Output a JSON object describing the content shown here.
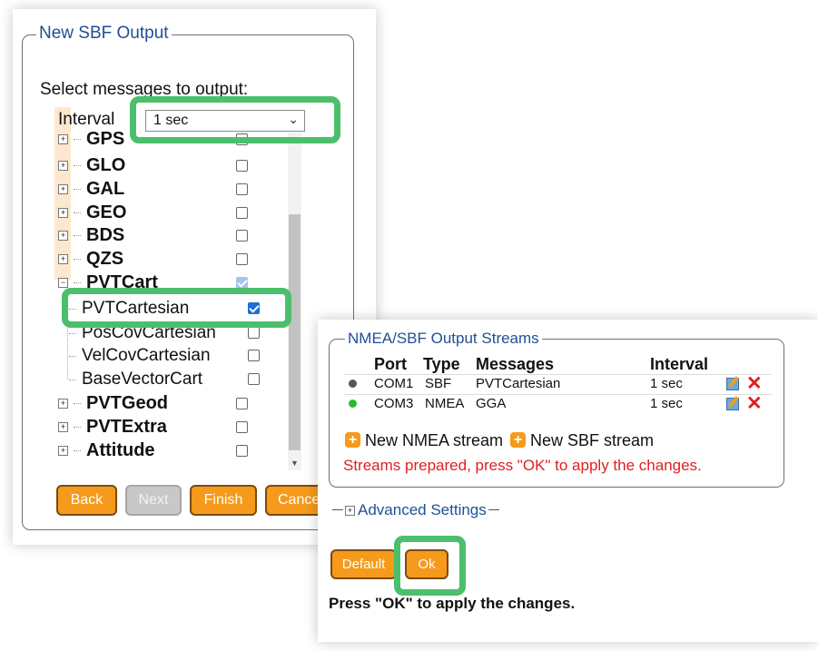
{
  "wizard": {
    "legend": "New SBF Output",
    "select_label": "Select messages to output:",
    "interval_label": "Interval",
    "interval_value": "1 sec",
    "tree": [
      {
        "label": "GPS",
        "group": true,
        "expanded": false,
        "checked": false
      },
      {
        "label": "GLO",
        "group": true,
        "expanded": false,
        "checked": false
      },
      {
        "label": "GAL",
        "group": true,
        "expanded": false,
        "checked": false
      },
      {
        "label": "GEO",
        "group": true,
        "expanded": false,
        "checked": false
      },
      {
        "label": "BDS",
        "group": true,
        "expanded": false,
        "checked": false
      },
      {
        "label": "QZS",
        "group": true,
        "expanded": false,
        "checked": false
      },
      {
        "label": "PVTCart",
        "group": true,
        "expanded": true,
        "checked": true
      },
      {
        "label": "PVTCartesian",
        "group": false,
        "checked": true
      },
      {
        "label": "PosCovCartesian",
        "group": false,
        "checked": false
      },
      {
        "label": "VelCovCartesian",
        "group": false,
        "checked": false
      },
      {
        "label": "BaseVectorCart",
        "group": false,
        "checked": false
      },
      {
        "label": "PVTGeod",
        "group": true,
        "expanded": false,
        "checked": false
      },
      {
        "label": "PVTExtra",
        "group": true,
        "expanded": false,
        "checked": false
      },
      {
        "label": "Attitude",
        "group": true,
        "expanded": false,
        "checked": false
      }
    ],
    "buttons": {
      "back": "Back",
      "next": "Next",
      "finish": "Finish",
      "cancel": "Cance"
    }
  },
  "streams": {
    "legend": "NMEA/SBF Output Streams",
    "headers": {
      "port": "Port",
      "type": "Type",
      "messages": "Messages",
      "interval": "Interval"
    },
    "rows": [
      {
        "status_color": "#555555",
        "port": "COM1",
        "type": "SBF",
        "messages": "PVTCartesian",
        "interval": "1 sec"
      },
      {
        "status_color": "#2eb82e",
        "port": "COM3",
        "type": "NMEA",
        "messages": "GGA",
        "interval": "1 sec"
      }
    ],
    "new_nmea": "New NMEA stream",
    "new_sbf": "New SBF stream",
    "status_message": "Streams prepared, press \"OK\" to apply the changes.",
    "advanced": "Advanced Settings",
    "buttons": {
      "default": "Default",
      "ok": "Ok"
    },
    "footer": "Press \"OK\" to apply the changes."
  },
  "colors": {
    "highlight": "#4cbf6c",
    "button": "#f59a1b",
    "legend": "#1f4f96",
    "error": "#e02020"
  }
}
